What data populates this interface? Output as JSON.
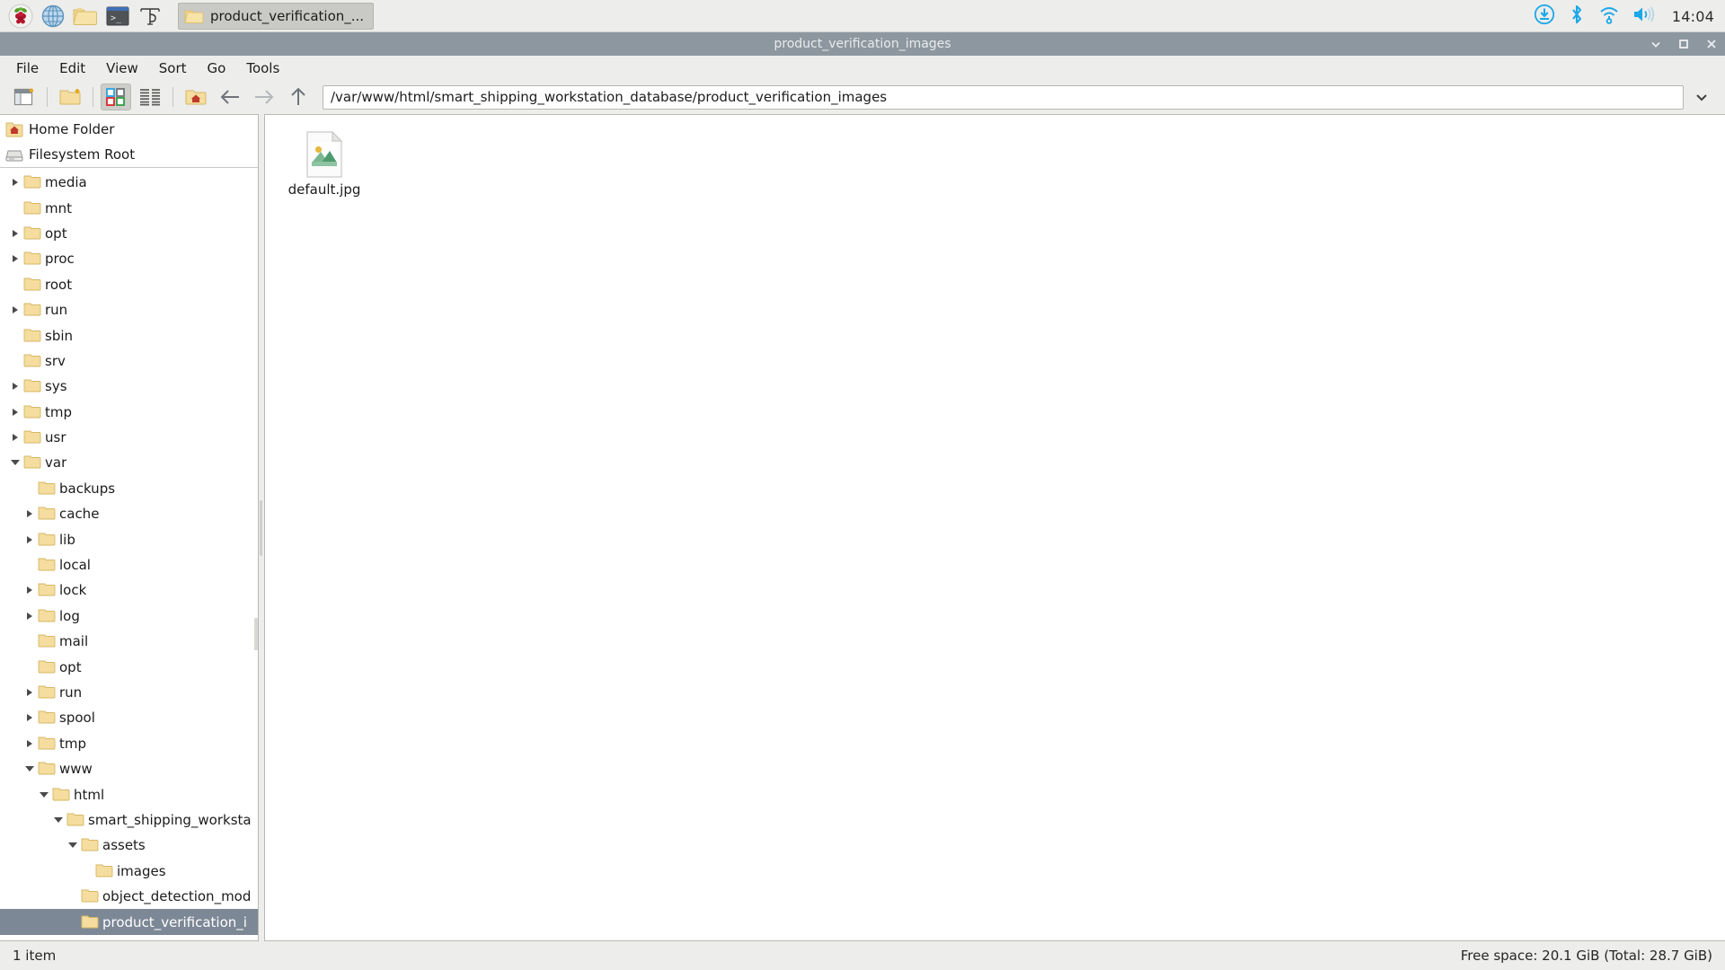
{
  "taskbar": {
    "launchers": [
      {
        "name": "raspberry-menu-icon",
        "label": "Raspberry Pi Menu"
      },
      {
        "name": "web-browser-icon",
        "label": "Web Browser"
      },
      {
        "name": "file-manager-icon",
        "label": "File Manager"
      },
      {
        "name": "terminal-icon",
        "label": "Terminal"
      },
      {
        "name": "thonny-icon",
        "label": "Thonny Python IDE"
      }
    ],
    "window_button": {
      "label": "product_verification_...",
      "icon": "folder-icon"
    },
    "tray": [
      {
        "name": "software-update-icon"
      },
      {
        "name": "bluetooth-icon"
      },
      {
        "name": "wifi-icon"
      },
      {
        "name": "volume-icon"
      }
    ],
    "clock": "14:04",
    "accent_color": "#1ba7e8"
  },
  "window": {
    "title": "product_verification_images",
    "titlebar_color": "#8d97a0",
    "buttons": [
      {
        "name": "minimize-button",
        "glyph": "chevron-down"
      },
      {
        "name": "maximize-button",
        "glyph": "square"
      },
      {
        "name": "close-button",
        "glyph": "x"
      }
    ]
  },
  "menubar": {
    "items": [
      {
        "label": "File"
      },
      {
        "label": "Edit"
      },
      {
        "label": "View"
      },
      {
        "label": "Sort"
      },
      {
        "label": "Go"
      },
      {
        "label": "Tools"
      }
    ]
  },
  "toolbar": {
    "buttons": [
      {
        "name": "new-tab-button",
        "icon": "new-tab-icon",
        "pressed": false
      },
      {
        "name": "new-folder-button",
        "icon": "new-folder-icon",
        "pressed": false
      },
      {
        "name": "icon-view-button",
        "icon": "icon-view-icon",
        "pressed": true
      },
      {
        "name": "list-view-button",
        "icon": "list-view-icon",
        "pressed": false
      },
      {
        "name": "home-button",
        "icon": "home-folder-icon",
        "pressed": false
      },
      {
        "name": "back-button",
        "icon": "arrow-left-icon",
        "pressed": false
      },
      {
        "name": "forward-button",
        "icon": "arrow-right-icon",
        "pressed": false
      },
      {
        "name": "up-button",
        "icon": "arrow-up-icon",
        "pressed": false
      }
    ],
    "path_value": "/var/www/html/smart_shipping_workstation_database/product_verification_images",
    "path_placeholder": "",
    "path_dropdown_icon": "chevron-down-icon"
  },
  "sidebar": {
    "places": [
      {
        "label": "Home Folder",
        "icon": "home-folder-icon"
      },
      {
        "label": "Filesystem Root",
        "icon": "drive-icon"
      }
    ],
    "tree": [
      {
        "label": "media",
        "depth": 1,
        "arrow": "collapsed"
      },
      {
        "label": "mnt",
        "depth": 1,
        "arrow": "none"
      },
      {
        "label": "opt",
        "depth": 1,
        "arrow": "collapsed"
      },
      {
        "label": "proc",
        "depth": 1,
        "arrow": "collapsed"
      },
      {
        "label": "root",
        "depth": 1,
        "arrow": "none"
      },
      {
        "label": "run",
        "depth": 1,
        "arrow": "collapsed"
      },
      {
        "label": "sbin",
        "depth": 1,
        "arrow": "none"
      },
      {
        "label": "srv",
        "depth": 1,
        "arrow": "none"
      },
      {
        "label": "sys",
        "depth": 1,
        "arrow": "collapsed"
      },
      {
        "label": "tmp",
        "depth": 1,
        "arrow": "collapsed"
      },
      {
        "label": "usr",
        "depth": 1,
        "arrow": "collapsed"
      },
      {
        "label": "var",
        "depth": 1,
        "arrow": "expanded"
      },
      {
        "label": "backups",
        "depth": 2,
        "arrow": "none"
      },
      {
        "label": "cache",
        "depth": 2,
        "arrow": "collapsed"
      },
      {
        "label": "lib",
        "depth": 2,
        "arrow": "collapsed"
      },
      {
        "label": "local",
        "depth": 2,
        "arrow": "none"
      },
      {
        "label": "lock",
        "depth": 2,
        "arrow": "collapsed"
      },
      {
        "label": "log",
        "depth": 2,
        "arrow": "collapsed"
      },
      {
        "label": "mail",
        "depth": 2,
        "arrow": "none"
      },
      {
        "label": "opt",
        "depth": 2,
        "arrow": "none"
      },
      {
        "label": "run",
        "depth": 2,
        "arrow": "collapsed"
      },
      {
        "label": "spool",
        "depth": 2,
        "arrow": "collapsed"
      },
      {
        "label": "tmp",
        "depth": 2,
        "arrow": "collapsed"
      },
      {
        "label": "www",
        "depth": 2,
        "arrow": "expanded"
      },
      {
        "label": "html",
        "depth": 3,
        "arrow": "expanded"
      },
      {
        "label": "smart_shipping_worksta",
        "depth": 4,
        "arrow": "expanded"
      },
      {
        "label": "assets",
        "depth": 5,
        "arrow": "expanded"
      },
      {
        "label": "images",
        "depth": 6,
        "arrow": "none"
      },
      {
        "label": "object_detection_mod",
        "depth": 5,
        "arrow": "none"
      },
      {
        "label": "product_verification_i",
        "depth": 5,
        "arrow": "none",
        "selected": true
      }
    ],
    "selection_color": "#7d8896"
  },
  "filelist": {
    "items": [
      {
        "name": "default.jpg",
        "icon": "image-file-icon"
      }
    ]
  },
  "statusbar": {
    "left": "1 item",
    "right": "Free space: 20.1 GiB (Total: 28.7 GiB)"
  }
}
